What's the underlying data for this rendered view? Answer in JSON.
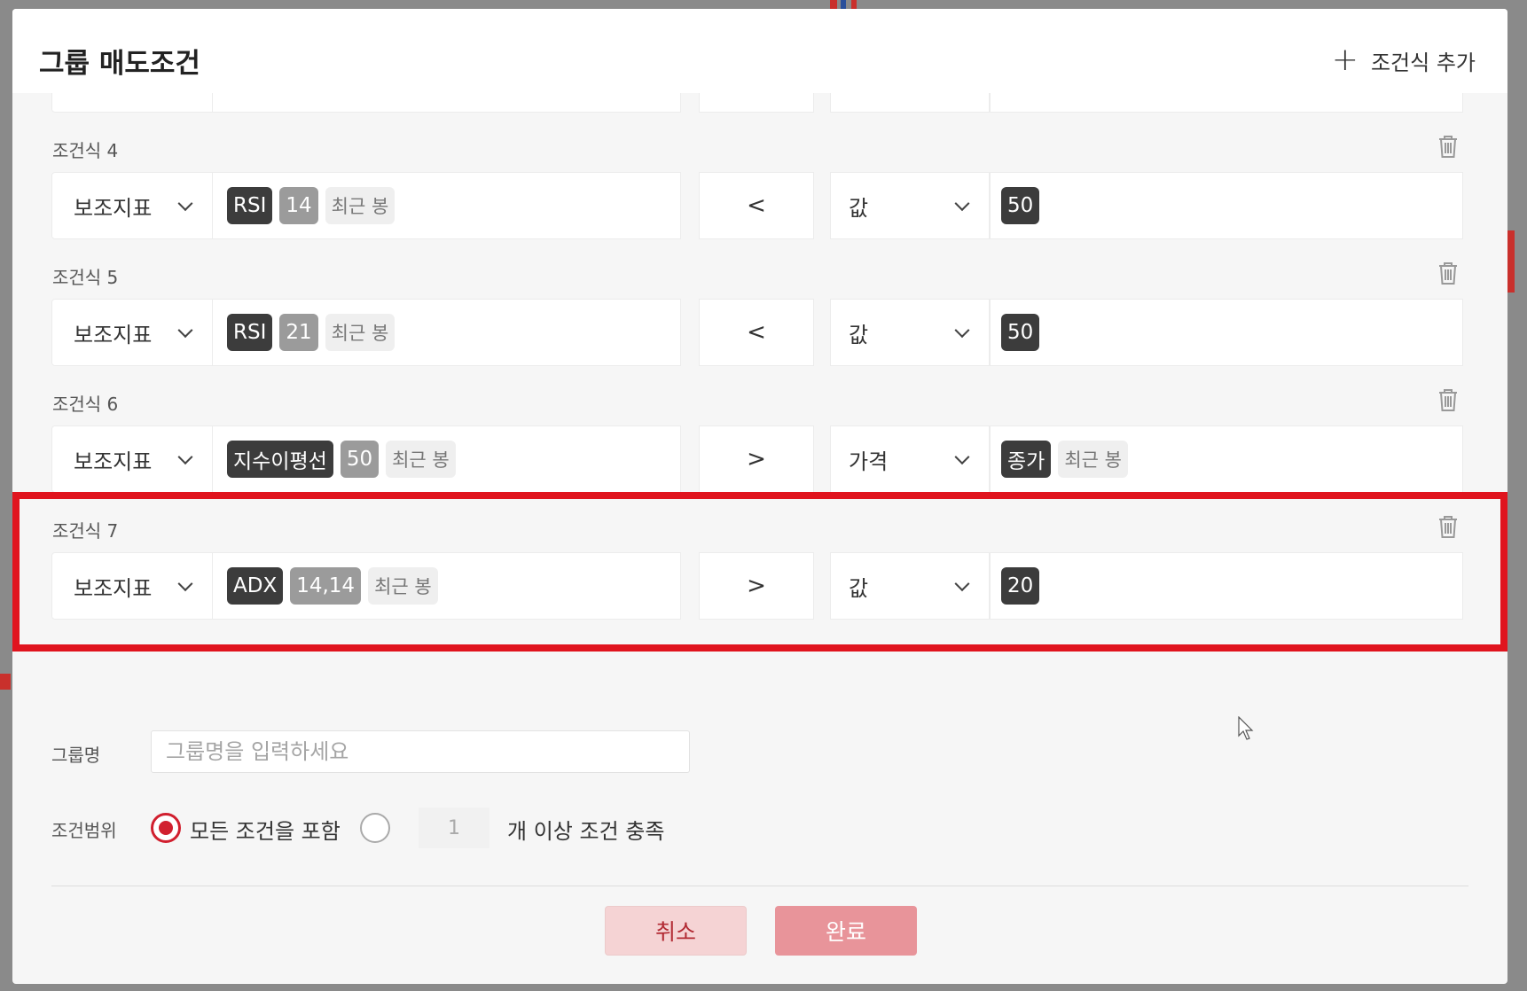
{
  "modal": {
    "title": "그룹 매도조건",
    "add_condition_label": "조건식 추가"
  },
  "conditions": [
    {
      "label": "조건식 4",
      "type": "보조지표",
      "indicator": "RSI",
      "param": "14",
      "candle": "최근 봉",
      "operator": "<",
      "value_type": "값",
      "value": "50",
      "value_extra": null
    },
    {
      "label": "조건식 5",
      "type": "보조지표",
      "indicator": "RSI",
      "param": "21",
      "candle": "최근 봉",
      "operator": "<",
      "value_type": "값",
      "value": "50",
      "value_extra": null
    },
    {
      "label": "조건식 6",
      "type": "보조지표",
      "indicator": "지수이평선",
      "param": "50",
      "candle": "최근 봉",
      "operator": ">",
      "value_type": "가격",
      "value": "종가",
      "value_extra": "최근 봉"
    },
    {
      "label": "조건식 7",
      "type": "보조지표",
      "indicator": "ADX",
      "param": "14,14",
      "candle": "최근 봉",
      "operator": ">",
      "value_type": "값",
      "value": "20",
      "value_extra": null
    }
  ],
  "group_name": {
    "label": "그룹명",
    "placeholder": "그룹명을 입력하세요",
    "value": ""
  },
  "scope": {
    "label": "조건범위",
    "option_all": "모든 조건을 포함",
    "option_all_selected": true,
    "count_value": "1",
    "option_count_suffix": "개 이상 조건 충족"
  },
  "buttons": {
    "cancel": "취소",
    "done": "완료"
  },
  "colors": {
    "accent_red": "#d11f2e",
    "highlight_border": "#e0141e",
    "chip_dark": "#3c3c3c",
    "chip_gray": "#9b9b9b"
  }
}
